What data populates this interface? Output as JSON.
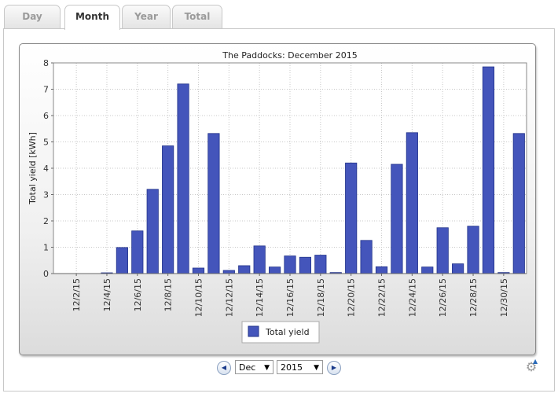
{
  "tabs": [
    {
      "label": "Day",
      "active": false
    },
    {
      "label": "Month",
      "active": true
    },
    {
      "label": "Year",
      "active": false
    },
    {
      "label": "Total",
      "active": false
    }
  ],
  "controls": {
    "prev_icon": "◀",
    "next_icon": "▶",
    "month_value": "Dec",
    "year_value": "2015",
    "dropdown_icon": "▼",
    "settings_icon": "⚙"
  },
  "colors": {
    "bar": "#4455bb",
    "bar_edge": "#22338a"
  },
  "chart_data": {
    "type": "bar",
    "title": "The Paddocks: December 2015",
    "xlabel": "",
    "ylabel": "Total yield [kWh]",
    "ylim": [
      0,
      8
    ],
    "yticks": [
      0,
      1,
      2,
      3,
      4,
      5,
      6,
      7,
      8
    ],
    "grid": true,
    "legend": "bottom",
    "categories": [
      "12/1/15",
      "12/2/15",
      "12/3/15",
      "12/4/15",
      "12/5/15",
      "12/6/15",
      "12/7/15",
      "12/8/15",
      "12/9/15",
      "12/10/15",
      "12/11/15",
      "12/12/15",
      "12/13/15",
      "12/14/15",
      "12/15/15",
      "12/16/15",
      "12/17/15",
      "12/18/15",
      "12/19/15",
      "12/20/15",
      "12/21/15",
      "12/22/15",
      "12/23/15",
      "12/24/15",
      "12/25/15",
      "12/26/15",
      "12/27/15",
      "12/28/15",
      "12/29/15",
      "12/30/15",
      "12/31/15"
    ],
    "tick_labels": [
      "12/2/15",
      "12/4/15",
      "12/6/15",
      "12/8/15",
      "12/10/15",
      "12/12/15",
      "12/14/15",
      "12/16/15",
      "12/18/15",
      "12/20/15",
      "12/22/15",
      "12/24/15",
      "12/26/15",
      "12/28/15",
      "12/30/15"
    ],
    "series": [
      {
        "name": "Total yield",
        "values": [
          0,
          0,
          0,
          0.02,
          0.99,
          1.62,
          3.2,
          4.85,
          7.2,
          0.21,
          5.32,
          0.12,
          0.3,
          1.05,
          0.25,
          0.67,
          0.62,
          0.7,
          0.04,
          4.2,
          1.26,
          0.26,
          4.15,
          5.35,
          0.25,
          1.74,
          0.37,
          1.8,
          7.85,
          0.04,
          5.32
        ]
      }
    ]
  }
}
